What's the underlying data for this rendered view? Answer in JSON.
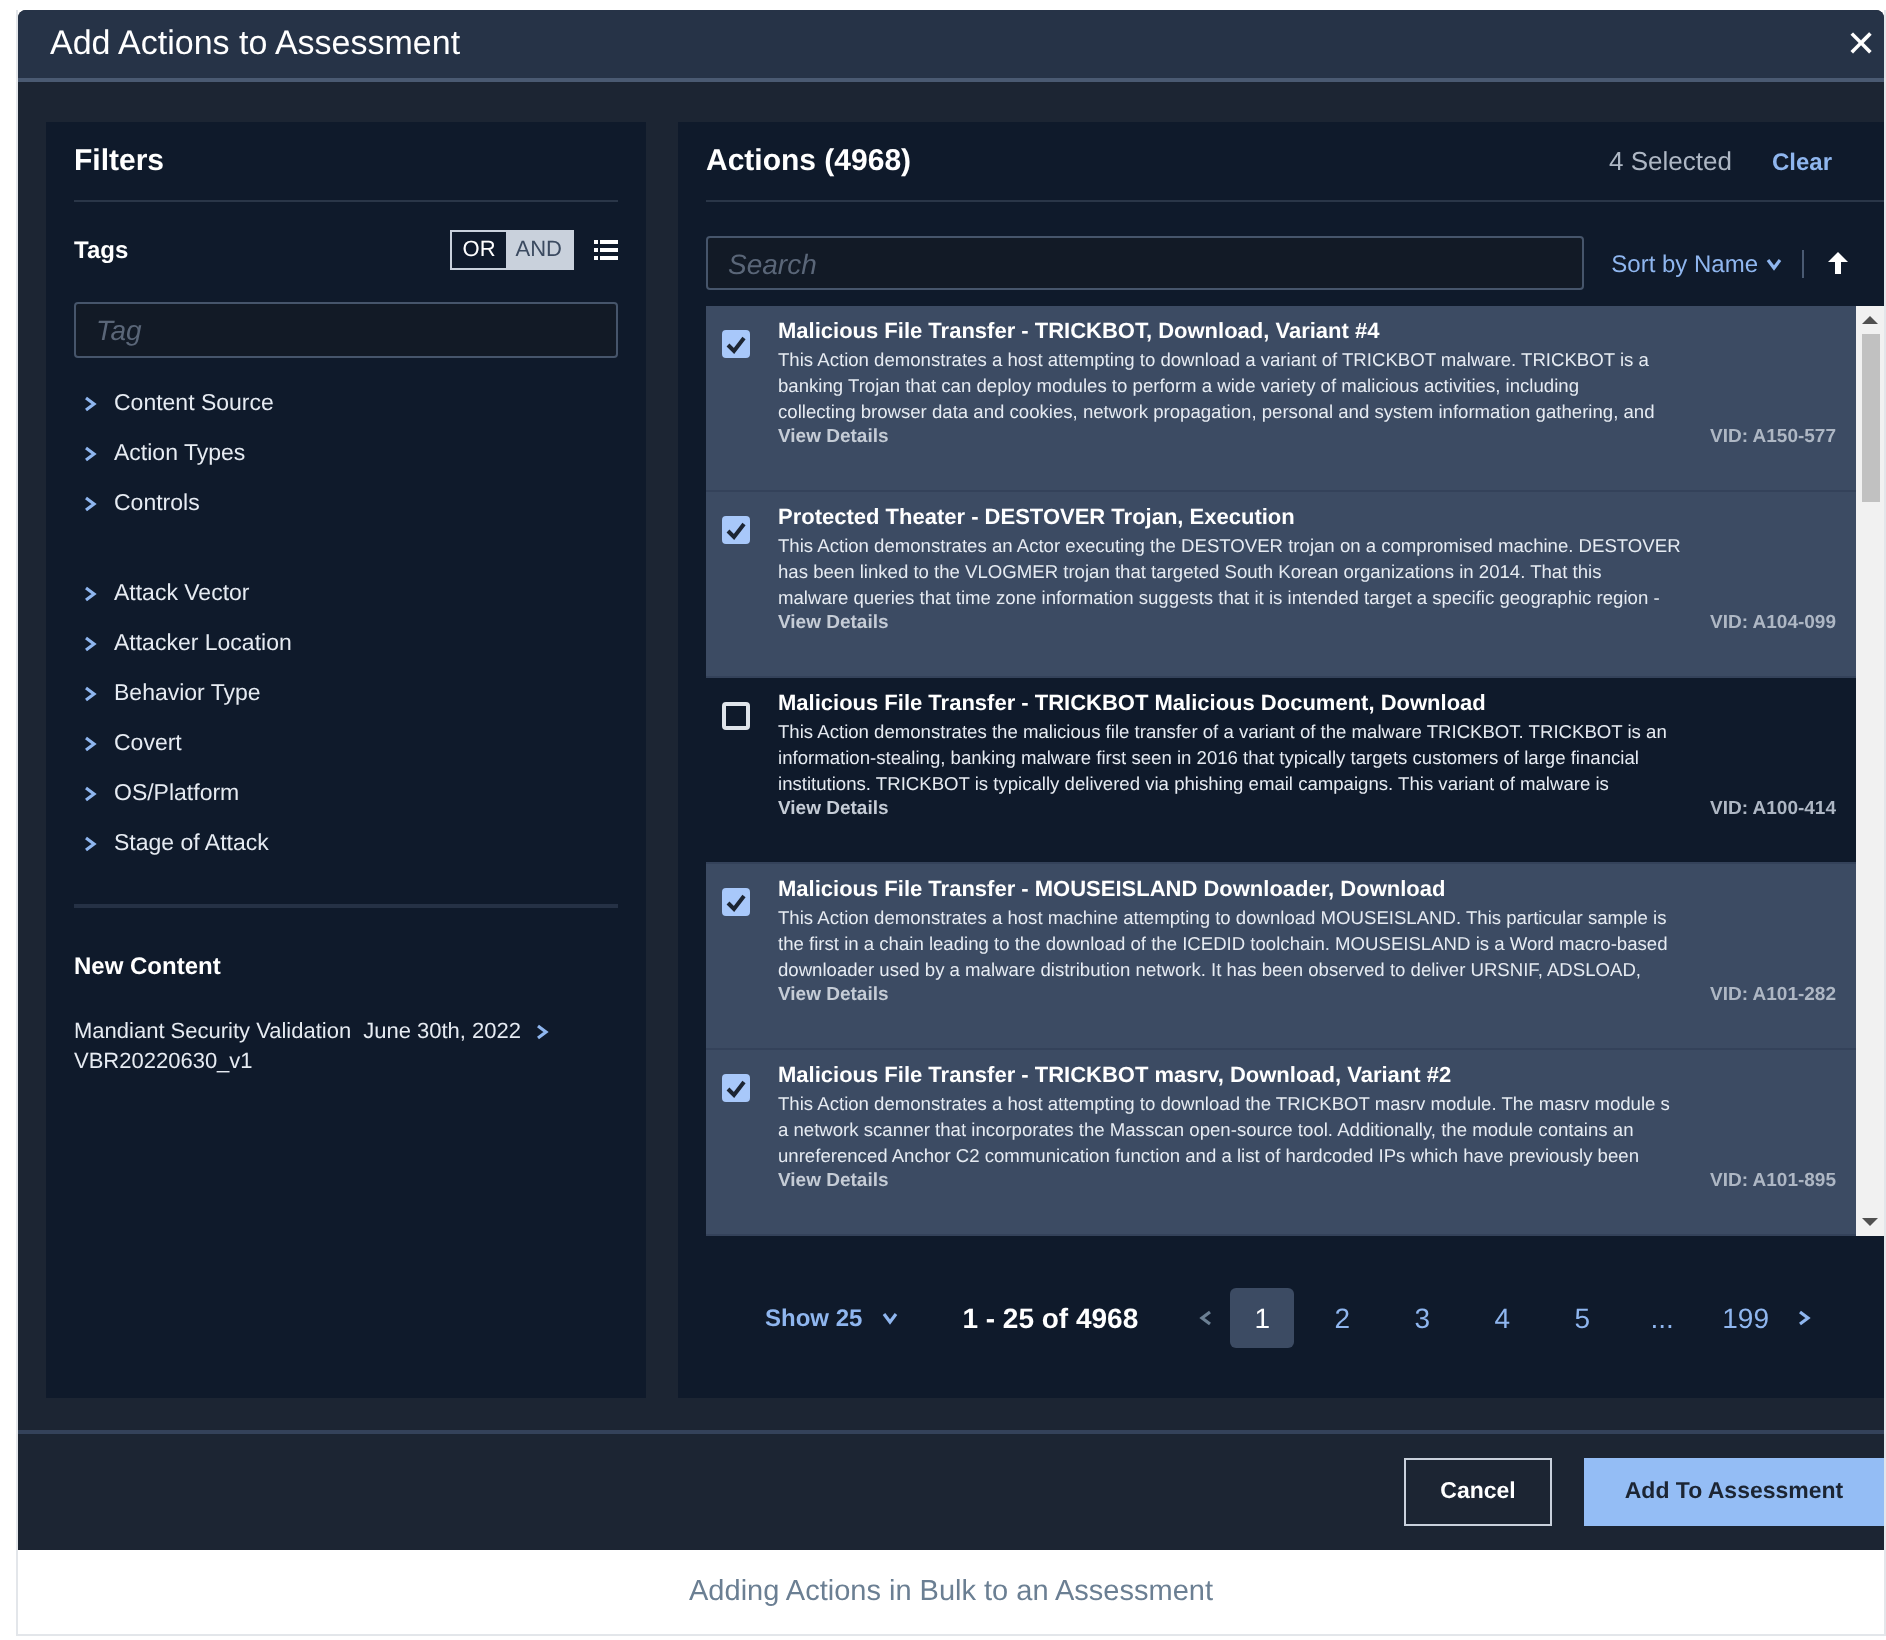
{
  "dialog": {
    "title": "Add Actions to Assessment",
    "close": "✕"
  },
  "filters": {
    "title": "Filters",
    "tags_label": "Tags",
    "logic": [
      {
        "label": "OR",
        "selected": false
      },
      {
        "label": "AND",
        "selected": true
      }
    ],
    "tag_placeholder": "Tag",
    "groups": [
      [
        "Content Source",
        "Action Types",
        "Controls"
      ],
      [
        "Attack Vector",
        "Attacker Location",
        "Behavior Type",
        "Covert",
        "OS/Platform",
        "Stage of Attack"
      ]
    ],
    "new_content": {
      "title": "New Content",
      "source": "Mandiant Security Validation",
      "date": "June 30th, 2022",
      "version": "VBR20220630_v1"
    }
  },
  "actions": {
    "title": "Actions (4968)",
    "selected_count": "4 Selected",
    "clear": "Clear",
    "search_placeholder": "Search",
    "sort": "Sort by Name",
    "items": [
      {
        "checked": true,
        "title": "Malicious File Transfer - TRICKBOT, Download, Variant #4",
        "lines": [
          "This Action demonstrates a host attempting to download a variant of TRICKBOT malware. TRICKBOT is a",
          "banking Trojan that can deploy modules to perform a wide variety of malicious activities, including",
          "collecting browser data and cookies, network propagation, personal and system information gathering, and"
        ],
        "link": "View Details",
        "vid": "VID: A150-577"
      },
      {
        "checked": true,
        "title": "Protected Theater - DESTOVER Trojan, Execution",
        "lines": [
          "This Action demonstrates an Actor executing the DESTOVER trojan on a compromised machine. DESTOVER",
          "has been linked to the VLOGMER trojan that targeted South Korean organizations in 2014. That this",
          "malware queries that time zone information suggests that it is intended target a specific geographic region -"
        ],
        "link": "View Details",
        "vid": "VID: A104-099"
      },
      {
        "checked": false,
        "title": "Malicious File Transfer - TRICKBOT Malicious Document, Download",
        "lines": [
          "This Action demonstrates the malicious file transfer of a variant of the malware TRICKBOT. TRICKBOT is an",
          "information-stealing, banking malware first seen in 2016 that typically targets customers of large financial",
          "institutions. TRICKBOT is typically delivered via phishing email campaigns. This variant of malware is"
        ],
        "link": "View Details",
        "vid": "VID: A100-414"
      },
      {
        "checked": true,
        "title": "Malicious File Transfer - MOUSEISLAND Downloader, Download",
        "lines": [
          "This Action demonstrates a host machine attempting to download MOUSEISLAND. This particular sample is",
          "the first in a chain leading to the download of the ICEDID toolchain. MOUSEISLAND is a Word macro-based",
          "downloader used by a malware distribution network. It has been observed to deliver URSNIF, ADSLOAD,"
        ],
        "link": "View Details",
        "vid": "VID: A101-282"
      },
      {
        "checked": true,
        "title": "Malicious File Transfer - TRICKBOT masrv, Download, Variant #2",
        "lines": [
          "This Action demonstrates a host attempting to download the TRICKBOT masrv module. The masrv module s",
          "a network scanner that incorporates the Masscan open-source tool. Additionally, the module contains an",
          "unreferenced Anchor C2 communication function and a list of hardcoded IPs which have previously been"
        ],
        "link": "View Details",
        "vid": "VID: A101-895"
      }
    ],
    "pagination": {
      "show": "Show 25",
      "range": "1 - 25 of 4968",
      "pages": [
        {
          "label": "1",
          "selected": true
        },
        {
          "label": "2",
          "selected": false
        },
        {
          "label": "3",
          "selected": false
        },
        {
          "label": "4",
          "selected": false
        },
        {
          "label": "5",
          "selected": false
        },
        {
          "label": "...",
          "selected": false
        },
        {
          "label": "199",
          "selected": false
        }
      ]
    }
  },
  "buttons": {
    "cancel": "Cancel",
    "add": "Add To Assessment"
  },
  "caption": "Adding Actions in Bulk to an Assessment"
}
